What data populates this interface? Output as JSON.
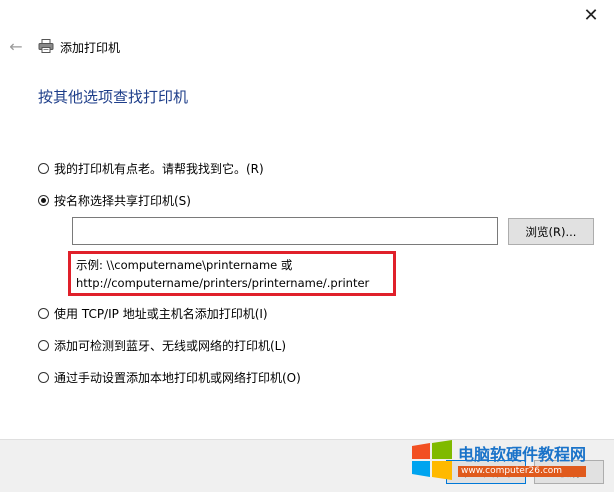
{
  "window": {
    "close_glyph": "✕",
    "back_glyph": "←",
    "title": "添加打印机"
  },
  "page": {
    "heading": "按其他选项查找打印机"
  },
  "options": [
    {
      "label": "我的打印机有点老。请帮我找到它。(R)",
      "checked": false
    },
    {
      "label": "按名称选择共享打印机(S)",
      "checked": true
    },
    {
      "label": "使用 TCP/IP 地址或主机名添加打印机(I)",
      "checked": false
    },
    {
      "label": "添加可检测到蓝牙、无线或网络的打印机(L)",
      "checked": false
    },
    {
      "label": "通过手动设置添加本地打印机或网络打印机(O)",
      "checked": false
    }
  ],
  "shared_printer": {
    "value": "",
    "browse_label": "浏览(R)...",
    "example_line1": "示例: \\\\computername\\printername 或",
    "example_line2": "http://computername/printers/printername/.printer"
  },
  "footer": {
    "next_label": "下一页(N)",
    "cancel_label": "取消"
  },
  "watermark": {
    "text": "电脑软硬件教程网",
    "url": "www.computer26.com"
  },
  "colors": {
    "heading": "#1e3e8a",
    "highlight_border": "#e0202a",
    "footer_bg": "#f0f0f0"
  }
}
